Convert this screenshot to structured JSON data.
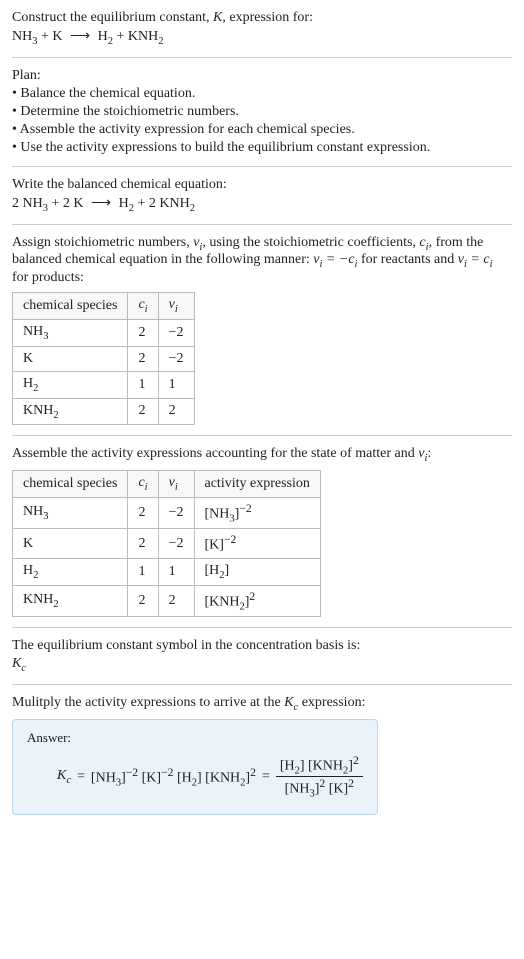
{
  "title_line1": "Construct the equilibrium constant, K, expression for:",
  "title_eq": "NH₃ + K ⟶ H₂ + KNH₂",
  "plan_heading": "Plan:",
  "plan_items": [
    "• Balance the chemical equation.",
    "• Determine the stoichiometric numbers.",
    "• Assemble the activity expression for each chemical species.",
    "• Use the activity expressions to build the equilibrium constant expression."
  ],
  "balanced_heading": "Write the balanced chemical equation:",
  "balanced_eq": "2 NH₃ + 2 K ⟶ H₂ + 2 KNH₂",
  "assign_text_a": "Assign stoichiometric numbers, ",
  "assign_text_b": ", using the stoichiometric coefficients, ",
  "assign_text_c": ", from the balanced chemical equation in the following manner: ",
  "assign_text_d": " for reactants and ",
  "assign_text_e": " for products:",
  "tbl1": {
    "headers": [
      "chemical species",
      "cᵢ",
      "νᵢ"
    ],
    "rows": [
      [
        "NH₃",
        "2",
        "−2"
      ],
      [
        "K",
        "2",
        "−2"
      ],
      [
        "H₂",
        "1",
        "1"
      ],
      [
        "KNH₂",
        "2",
        "2"
      ]
    ]
  },
  "assemble_text_a": "Assemble the activity expressions accounting for the state of matter and ",
  "assemble_text_b": ":",
  "tbl2": {
    "headers": [
      "chemical species",
      "cᵢ",
      "νᵢ",
      "activity expression"
    ],
    "rows": [
      [
        "NH₃",
        "2",
        "−2",
        "[NH₃]⁻²"
      ],
      [
        "K",
        "2",
        "−2",
        "[K]⁻²"
      ],
      [
        "H₂",
        "1",
        "1",
        "[H₂]"
      ],
      [
        "KNH₂",
        "2",
        "2",
        "[KNH₂]²"
      ]
    ]
  },
  "symbol_text": "The equilibrium constant symbol in the concentration basis is:",
  "symbol_val": "K_c",
  "multiply_text_a": "Mulitply the activity expressions to arrive at the ",
  "multiply_text_b": " expression:",
  "answer_label": "Answer:",
  "answer_lhs": "K_c = [NH₃]⁻² [K]⁻² [H₂] [KNH₂]² = ",
  "answer_num": "[H₂] [KNH₂]²",
  "answer_den": "[NH₃]² [K]²",
  "chart_data": {
    "type": "table",
    "tables": [
      {
        "title": "Stoichiometric numbers",
        "columns": [
          "chemical species",
          "c_i",
          "nu_i"
        ],
        "rows": [
          {
            "chemical species": "NH3",
            "c_i": 2,
            "nu_i": -2
          },
          {
            "chemical species": "K",
            "c_i": 2,
            "nu_i": -2
          },
          {
            "chemical species": "H2",
            "c_i": 1,
            "nu_i": 1
          },
          {
            "chemical species": "KNH2",
            "c_i": 2,
            "nu_i": 2
          }
        ]
      },
      {
        "title": "Activity expressions",
        "columns": [
          "chemical species",
          "c_i",
          "nu_i",
          "activity expression"
        ],
        "rows": [
          {
            "chemical species": "NH3",
            "c_i": 2,
            "nu_i": -2,
            "activity expression": "[NH3]^-2"
          },
          {
            "chemical species": "K",
            "c_i": 2,
            "nu_i": -2,
            "activity expression": "[K]^-2"
          },
          {
            "chemical species": "H2",
            "c_i": 1,
            "nu_i": 1,
            "activity expression": "[H2]"
          },
          {
            "chemical species": "KNH2",
            "c_i": 2,
            "nu_i": 2,
            "activity expression": "[KNH2]^2"
          }
        ]
      }
    ],
    "equilibrium_constant": "K_c = ([H2] * [KNH2]^2) / ([NH3]^2 * [K]^2)"
  }
}
